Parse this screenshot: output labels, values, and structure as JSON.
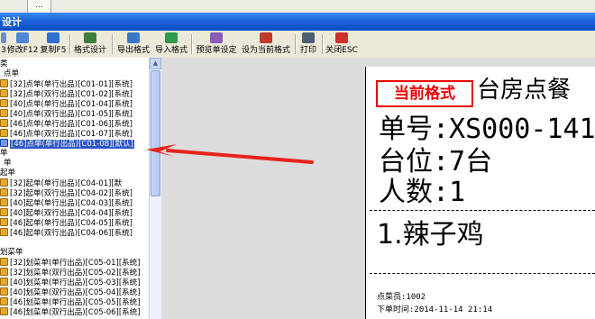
{
  "top_tab": {
    "label": "..."
  },
  "window": {
    "title": "设计"
  },
  "toolbar": {
    "items": [
      {
        "label": "3",
        "icon": "partial-icon",
        "color": "#6f8fc4"
      },
      {
        "label": "修改F12",
        "icon": "edit-icon",
        "color": "#4f86d1"
      },
      {
        "label": "复制F5",
        "icon": "copy-icon",
        "color": "#2f6fd1"
      },
      {
        "label": "格式设计",
        "icon": "design-icon",
        "color": "#3d7f3a"
      },
      {
        "label": "导出格式",
        "icon": "export-icon",
        "color": "#3b78c4"
      },
      {
        "label": "导入格式",
        "icon": "import-icon",
        "color": "#2e9a4e"
      },
      {
        "label": "预览单设定",
        "icon": "preview-setting-icon",
        "color": "#8a5bb5"
      },
      {
        "label": "设为当前格式",
        "icon": "set-current-icon",
        "color": "#c0392b"
      },
      {
        "label": "打印",
        "icon": "printer-icon",
        "color": "#4e5f74"
      },
      {
        "label": "关闭ESC",
        "icon": "close-icon",
        "color": "#d0302a"
      }
    ]
  },
  "tree": {
    "rows": [
      {
        "text": "类",
        "indent": 0,
        "icon": false
      },
      {
        "text": "点单",
        "indent": 4,
        "icon": false
      },
      {
        "text": "[32]点单(单行出品)[C01-01][系统]",
        "indent": 0,
        "icon": true
      },
      {
        "text": "[32]点单(双行出品)[C01-02][系统]",
        "indent": 0,
        "icon": true
      },
      {
        "text": "[40]点单(单行出品)[C01-04][系统]",
        "indent": 0,
        "icon": true
      },
      {
        "text": "[40]点单(双行出品)[C01-05][系统]",
        "indent": 0,
        "icon": true
      },
      {
        "text": "[46]点单(单行出品)[C01-06][系统]",
        "indent": 0,
        "icon": true
      },
      {
        "text": "[46]点单(双行出品)[C01-07][系统]",
        "indent": 0,
        "icon": true
      },
      {
        "text": "[46]点单(单行出品)[C01-08][默认]",
        "indent": 0,
        "icon": true,
        "selected": true
      },
      {
        "text": "单",
        "indent": 0,
        "icon": false
      },
      {
        "text": "单",
        "indent": 4,
        "icon": false
      },
      {
        "text": "起单",
        "indent": 0,
        "icon": false
      },
      {
        "text": "[32]起单(单行出品)[C04-01][默",
        "indent": 0,
        "icon": true
      },
      {
        "text": "[32]起单(双行出品)[C04-02][系统]",
        "indent": 0,
        "icon": true
      },
      {
        "text": "[40]起单(单行出品)[C04-03][系统]",
        "indent": 0,
        "icon": true
      },
      {
        "text": "[40]起单(双行出品)[C04-04][系统]",
        "indent": 0,
        "icon": true
      },
      {
        "text": "[46]起单(单行出品)[C04-05][系统]",
        "indent": 0,
        "icon": true
      },
      {
        "text": "[46]起单(双行出品)[C04-06][系统]",
        "indent": 0,
        "icon": true
      },
      {
        "text": "",
        "indent": 0,
        "icon": false
      },
      {
        "text": "划菜单",
        "indent": 0,
        "icon": false
      },
      {
        "text": "[32]划菜单(单行出品)[C05-01][系统]",
        "indent": 0,
        "icon": true
      },
      {
        "text": "[32]划菜单(双行出品)[C05-02][系统]",
        "indent": 0,
        "icon": true
      },
      {
        "text": "[40]划菜单(单行出品)[C05-03][系统]",
        "indent": 0,
        "icon": true
      },
      {
        "text": "[40]划菜单(双行出品)[C05-04][系统]",
        "indent": 0,
        "icon": true
      },
      {
        "text": "[46]划菜单(单行出品)[C05-05][系统]",
        "indent": 0,
        "icon": true
      },
      {
        "text": "[46]划菜单(双行出品)[C05-06][系统]",
        "indent": 0,
        "icon": true
      }
    ]
  },
  "preview": {
    "badge": "当前格式",
    "title": "台房点餐",
    "order_no": "单号:XS000-141",
    "table": "台位:7台",
    "guests": "人数:1",
    "item": "1.辣子鸡",
    "server": "点菜员:1002",
    "order_time": "下单时间:2014-11-14 21:14"
  },
  "colors": {
    "accent": "#e00000",
    "selection": "#2d55c7",
    "titlebar": "#1c62d8"
  }
}
